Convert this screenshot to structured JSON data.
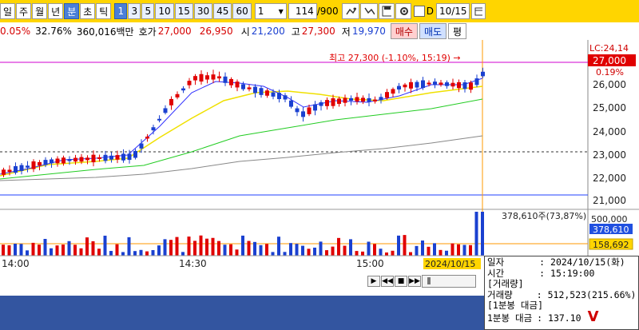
{
  "toolbar": {
    "periods": [
      "일",
      "주",
      "월",
      "년",
      "분",
      "초",
      "틱"
    ],
    "selected_period": "분",
    "intervals": [
      "1",
      "3",
      "5",
      "10",
      "15",
      "30",
      "45",
      "60"
    ],
    "selected_interval": "1",
    "unit_value": "1",
    "count_value": "114",
    "count_total": "/900",
    "check_label": "D",
    "date_value": "10/15"
  },
  "quote": {
    "change_rate": "0.05%",
    "turnover": "32.76%",
    "trade_amount": "360,016백만",
    "bid_label": "호가",
    "bid_sell": "27,000",
    "bid_buy": "26,950",
    "open_label": "시",
    "open": "21,200",
    "high_label": "고",
    "high": "27,300",
    "low_label": "저",
    "low": "19,970",
    "buy_label": "매수",
    "sell_label": "매도",
    "eval_label": "평"
  },
  "chart": {
    "lc_label": "LC:24,14",
    "current_price": "27,000",
    "current_change": "0.19%",
    "high_annotation": "최고 27,300 (-1.10%, 15:19) →",
    "volume_annotation": "378,610주(73,87%)",
    "volume_axis_label": "500,000",
    "current_volume": "378,610",
    "ma_volume": "158,692",
    "cursor_time_label": "2024/10/15"
  },
  "chart_data": {
    "type": "candlestick",
    "price_axis": [
      "27,000",
      "26,000",
      "25,000",
      "24,000",
      "23,000",
      "22,000",
      "21,000"
    ],
    "time_axis": [
      "14:00",
      "14:30",
      "15:00"
    ],
    "reference_price": 23000,
    "high": 27300,
    "high_time": "15:19"
  },
  "info": {
    "date_label": "일자",
    "date_value": ": 2024/10/15(화)",
    "time_label": "시간",
    "time_value": ": 15:19:00",
    "volume_header": "[거래량]",
    "volume_label": "거래량",
    "volume_value": ": 512,523(215.66%)",
    "amount_header": "[1분봉 대금]",
    "amount_label": "1분봉 대금",
    "amount_value": ": 137.10",
    "logo_mark": "V"
  }
}
